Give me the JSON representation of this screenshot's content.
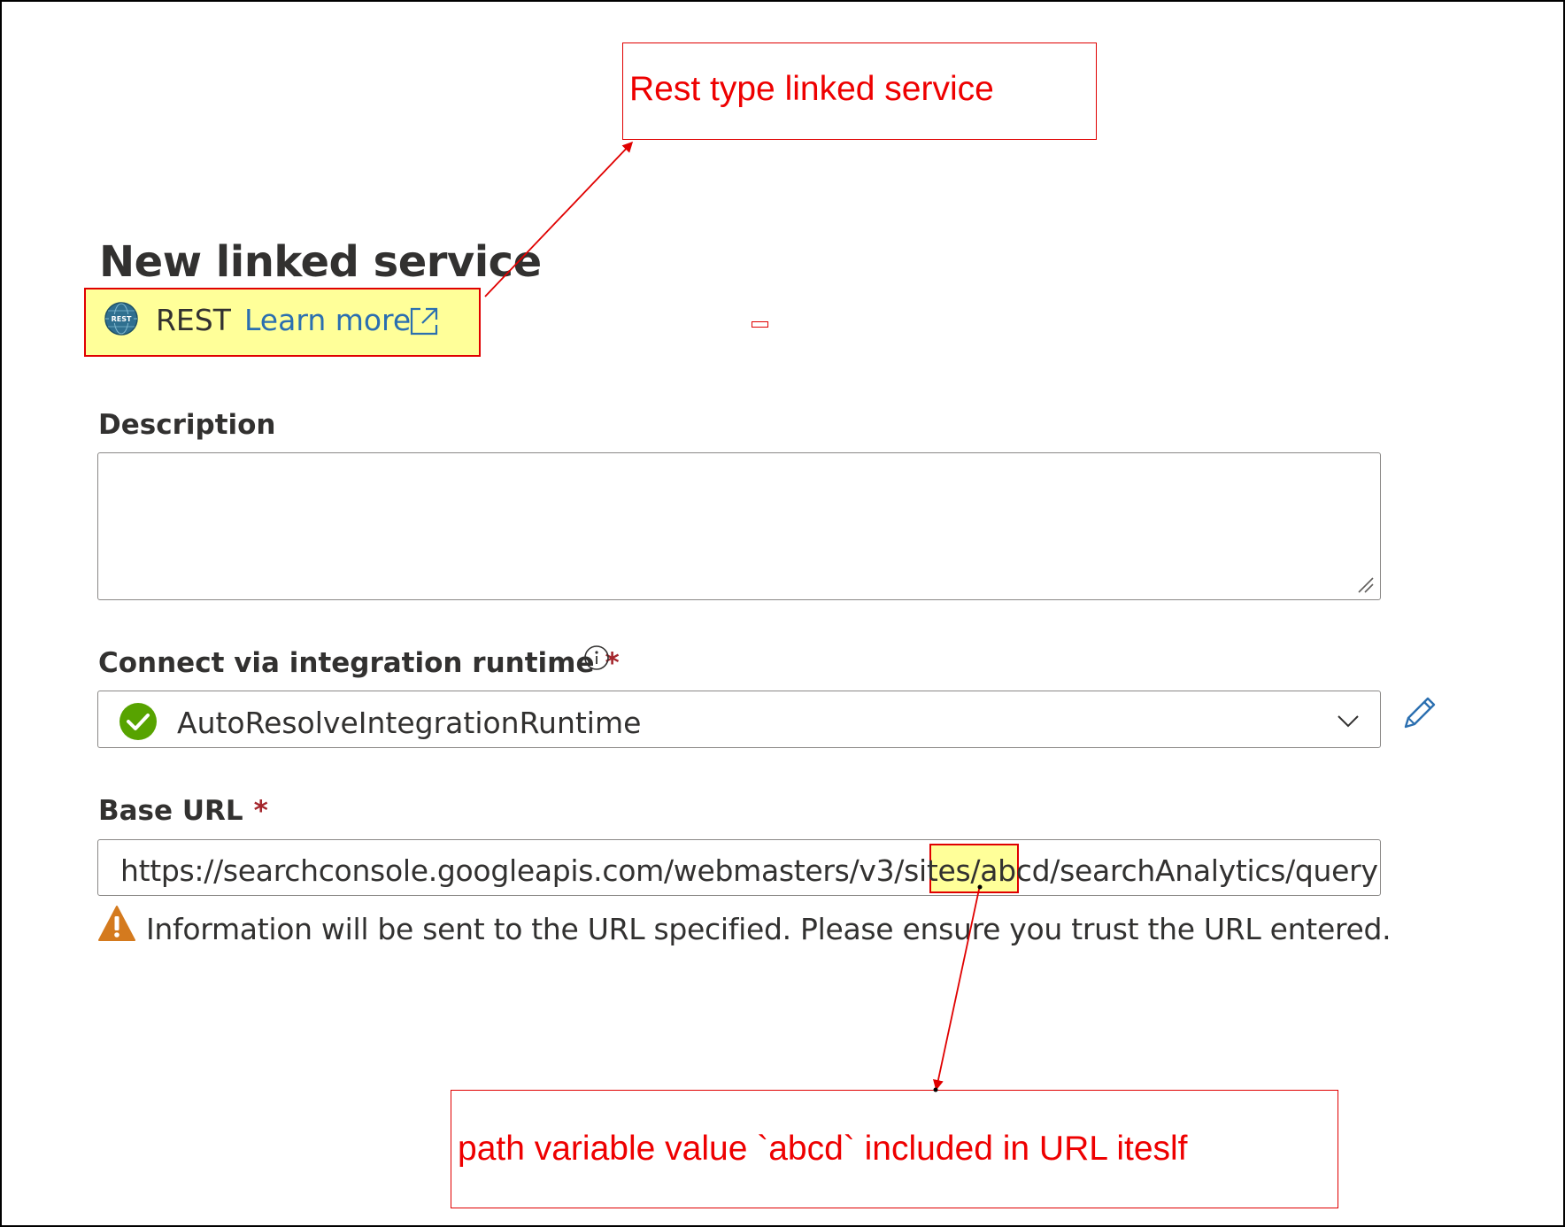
{
  "annotations": {
    "top_note": "Rest type linked service",
    "bottom_note": "path variable value `abcd` included in URL iteslf"
  },
  "panel": {
    "title": "New linked service",
    "service_type": "REST",
    "learn_more": "Learn more",
    "description": {
      "label": "Description",
      "value": ""
    },
    "integration_runtime": {
      "label": "Connect via integration runtime",
      "required_mark": "*",
      "selected": "AutoResolveIntegrationRuntime"
    },
    "base_url": {
      "label": "Base URL",
      "required_mark": "*",
      "value": "https://searchconsole.googleapis.com/webmasters/v3/sites/abcd/searchAnalytics/query"
    },
    "warning": "Information will be sent to the URL specified. Please ensure you trust the URL entered."
  },
  "icons": {
    "rest": "rest-globe-icon",
    "external_link": "external-link-icon",
    "info": "info-icon",
    "status": "check-circle-icon",
    "dropdown": "chevron-down-icon",
    "edit": "pencil-icon",
    "warning": "warning-triangle-icon"
  },
  "colors": {
    "annotation": "#ee0000",
    "highlight": "#ffff99",
    "link": "#2b6fb0",
    "required": "#a4262c",
    "success": "#57a300",
    "warning": "#d47a1e"
  }
}
